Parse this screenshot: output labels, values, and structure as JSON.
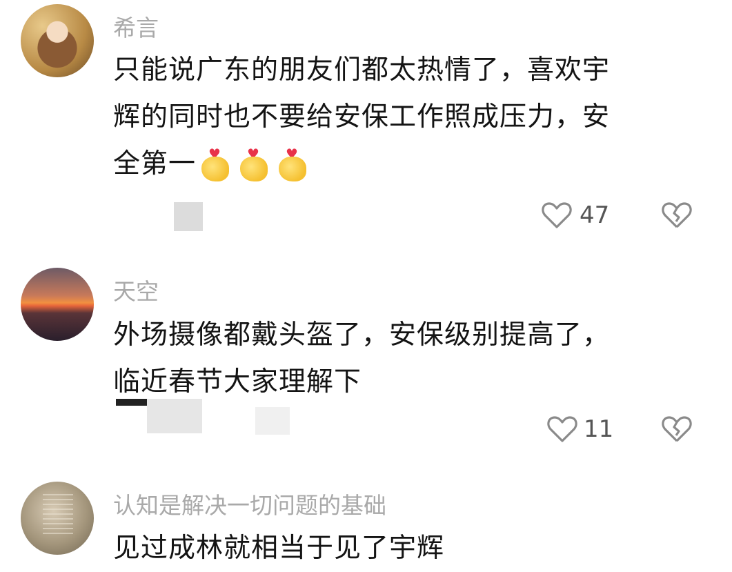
{
  "comments": [
    {
      "username": "希言",
      "text_lines": [
        "只能说广东的朋友们都太热情了，喜欢宇",
        "辉的同时也不要给安保工作照成压力，安",
        "全第一"
      ],
      "like_count": "47",
      "icons": {
        "like": "heart-outline-icon",
        "dislike": "broken-heart-icon",
        "emoji": "finger-heart-emoji"
      }
    },
    {
      "username": "天空",
      "text_lines": [
        "外场摄像都戴头盔了，安保级别提高了，",
        "临近春节大家理解下"
      ],
      "like_count": "11",
      "icons": {
        "like": "heart-outline-icon",
        "dislike": "broken-heart-icon"
      }
    },
    {
      "username": "认知是解决一切问题的基础",
      "text_lines": [
        "见过成林就相当于见了宇辉"
      ]
    }
  ],
  "colors": {
    "username": "#a9a9a9",
    "text": "#141414",
    "icon": "#8a8a8a"
  }
}
